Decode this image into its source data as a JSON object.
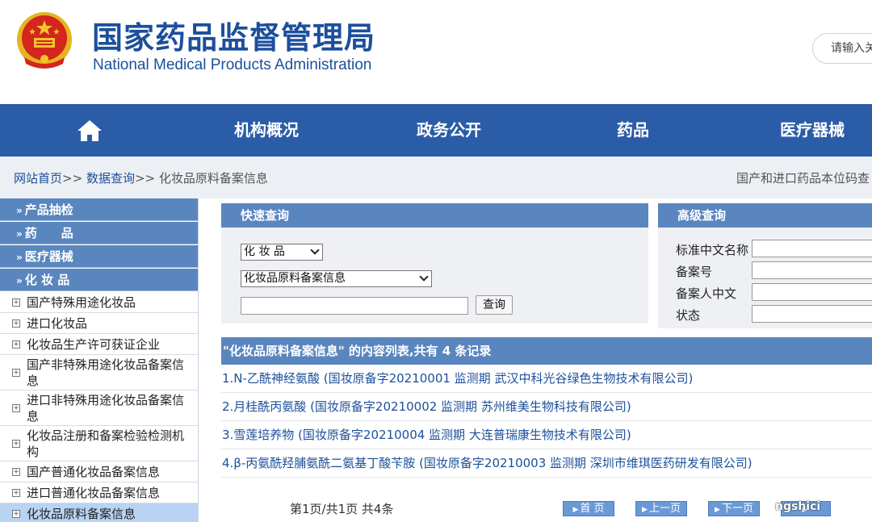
{
  "header": {
    "title_cn": "国家药品监督管理局",
    "title_en": "National Medical Products Administration",
    "search_placeholder": "请输入关",
    "brand_color": "#1c4f9c"
  },
  "nav": {
    "home_icon": "home-icon",
    "items": [
      "机构概况",
      "政务公开",
      "药品",
      "医疗器械"
    ],
    "bg_color": "#2b5ca7"
  },
  "breadcrumb": {
    "home": "网站首页",
    "sep": ">>",
    "data_query": "数据查询",
    "current": "化妆品原料备案信息",
    "marquee": "国产和进口药品本位码查"
  },
  "sidebar": {
    "categories": [
      "产品抽检",
      "药　　品",
      "医疗器械",
      "化 妆 品"
    ],
    "items": [
      "国产特殊用途化妆品",
      "进口化妆品",
      "化妆品生产许可获证企业",
      "国产非特殊用途化妆品备案信息",
      "进口非特殊用途化妆品备案信息",
      "化妆品注册和备案检验检测机构",
      "国产普通化妆品备案信息",
      "进口普通化妆品备案信息",
      "化妆品原料备案信息"
    ]
  },
  "quick_query": {
    "title": "快速查询",
    "category_value": "化 妆 品",
    "subcategory_value": "化妆品原料备案信息",
    "keyword_value": "",
    "button": "查询"
  },
  "advanced_query": {
    "title": "高级查询",
    "fields": [
      "标准中文名称",
      "备案号",
      "备案人中文",
      "状态"
    ]
  },
  "results": {
    "header": "\"化妆品原料备案信息\" 的内容列表,共有 4 条记录",
    "items": [
      "1.N-乙酰神经氨酸 (国妆原备字20210001 监测期 武汉中科光谷绿色生物技术有限公司)",
      "2.月桂酰丙氨酸 (国妆原备字20210002 监测期 苏州维美生物科技有限公司)",
      "3.雪莲培养物 (国妆原备字20210004 监测期 大连普瑞康生物技术有限公司)",
      "4.β-丙氨酰羟脯氨酰二氨基丁酸苄胺 (国妆原备字20210003 监测期 深圳市维琪医药研发有限公司)"
    ],
    "page_info": "第1页/共1页 共4条",
    "pager": [
      "首 页",
      "上一页",
      "下一页"
    ]
  },
  "watermark": "ngshici"
}
